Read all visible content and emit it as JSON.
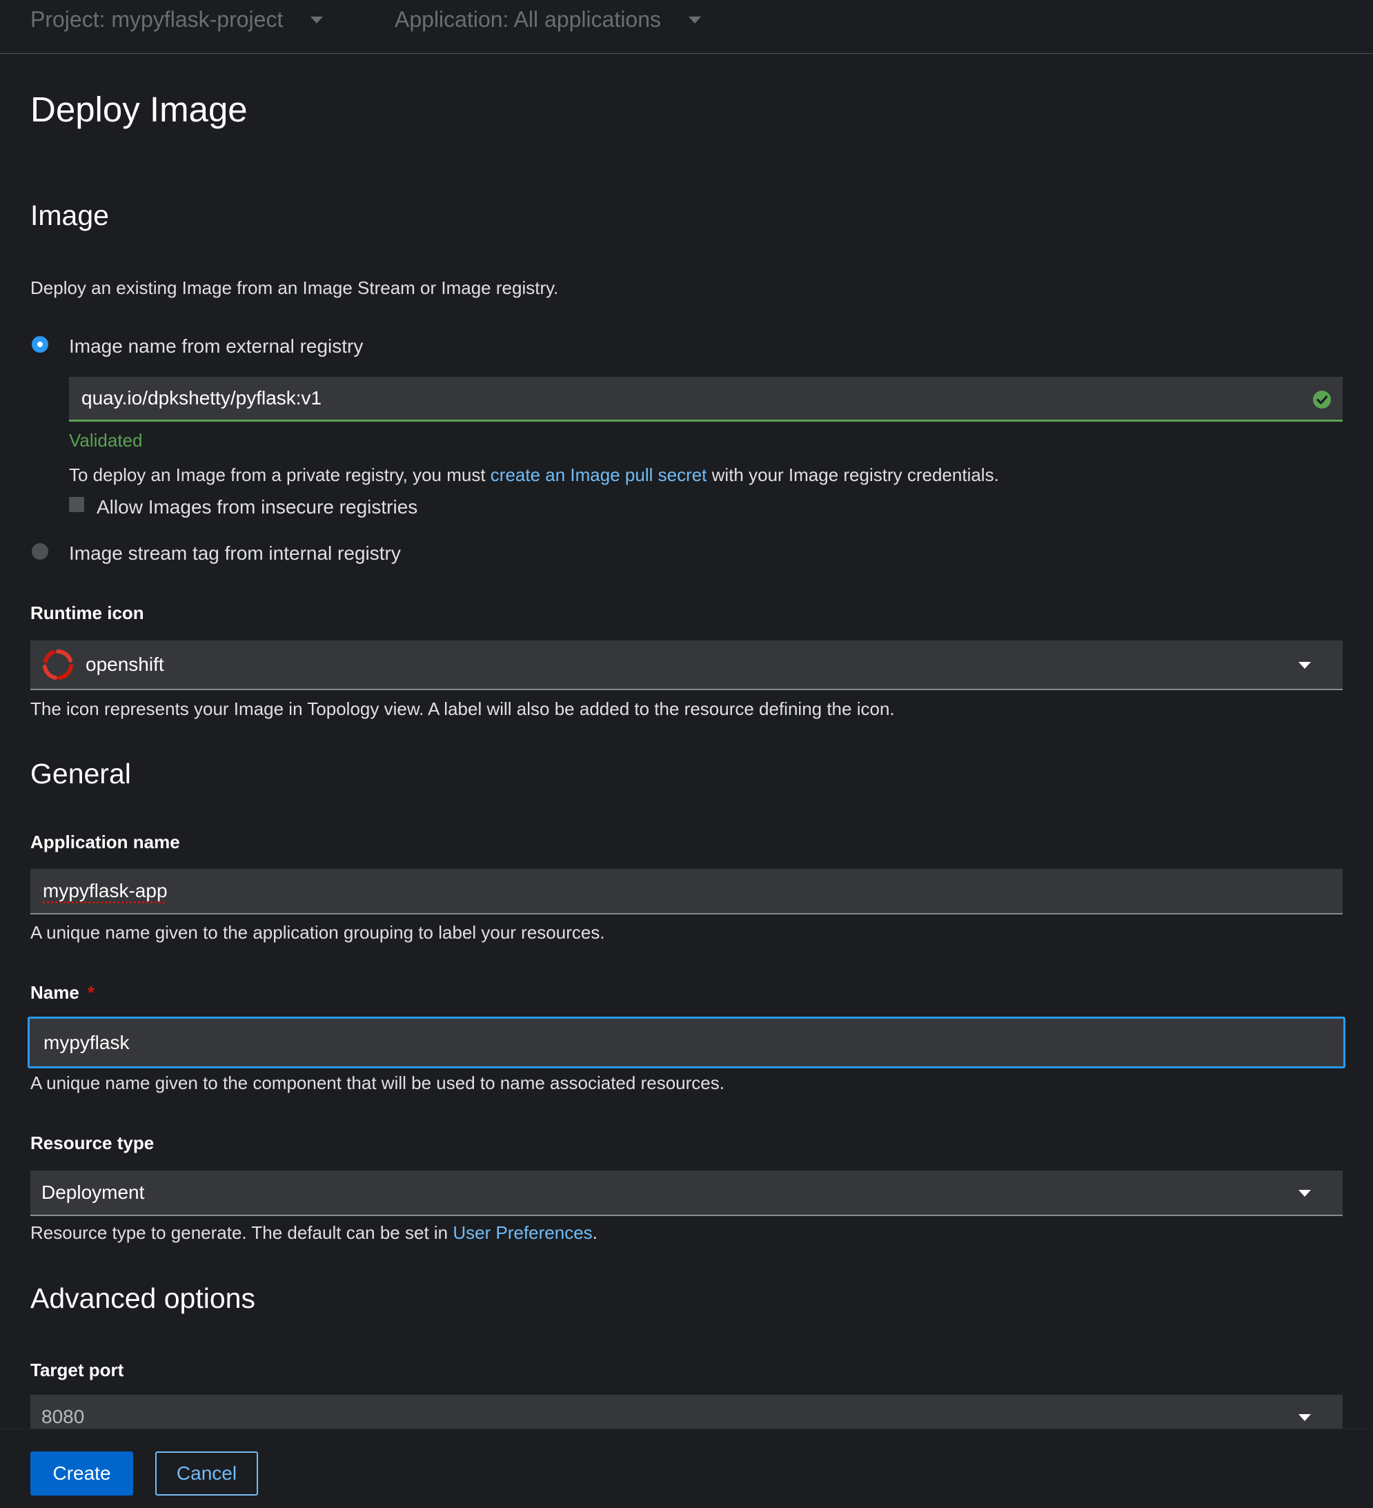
{
  "topbar": {
    "project_selector": "Project: mypyflask-project",
    "application_selector": "Application: All applications"
  },
  "page_title": "Deploy Image",
  "image_section": {
    "heading": "Image",
    "description": "Deploy an existing Image from an Image Stream or Image registry.",
    "option_external": "Image name from external registry",
    "external_value": "quay.io/dpkshetty/pyflask:v1",
    "validation_text": "Validated",
    "private_note_before": "To deploy an Image from a private registry, you must ",
    "private_note_link": "create an Image pull secret",
    "private_note_after": " with your Image registry credentials.",
    "insecure_checkbox_label": "Allow Images from insecure registries",
    "option_internal": "Image stream tag from internal registry"
  },
  "runtime_icon": {
    "label": "Runtime icon",
    "value": "openshift",
    "icon": "openshift-icon",
    "help": "The icon represents your Image in Topology view. A label will also be added to the resource defining the icon."
  },
  "general": {
    "heading": "General",
    "application_name_label": "Application name",
    "application_name_value": "mypyflask-app",
    "application_name_help": "A unique name given to the application grouping to label your resources.",
    "name_label": "Name",
    "name_required": "*",
    "name_value": "mypyflask",
    "name_help": "A unique name given to the component that will be used to name associated resources.",
    "resource_type_label": "Resource type",
    "resource_type_value": "Deployment",
    "resource_type_help_before": "Resource type to generate. The default can be set in ",
    "resource_type_help_link": "User Preferences",
    "resource_type_help_after": "."
  },
  "advanced": {
    "heading": "Advanced options",
    "target_port_label": "Target port",
    "target_port_value": "8080"
  },
  "footer": {
    "create_label": "Create",
    "cancel_label": "Cancel"
  },
  "colors": {
    "primary": "#0066cc",
    "link": "#73bcf7",
    "success": "#5ba352",
    "focus": "#2b9af3",
    "required": "#c9190b"
  }
}
